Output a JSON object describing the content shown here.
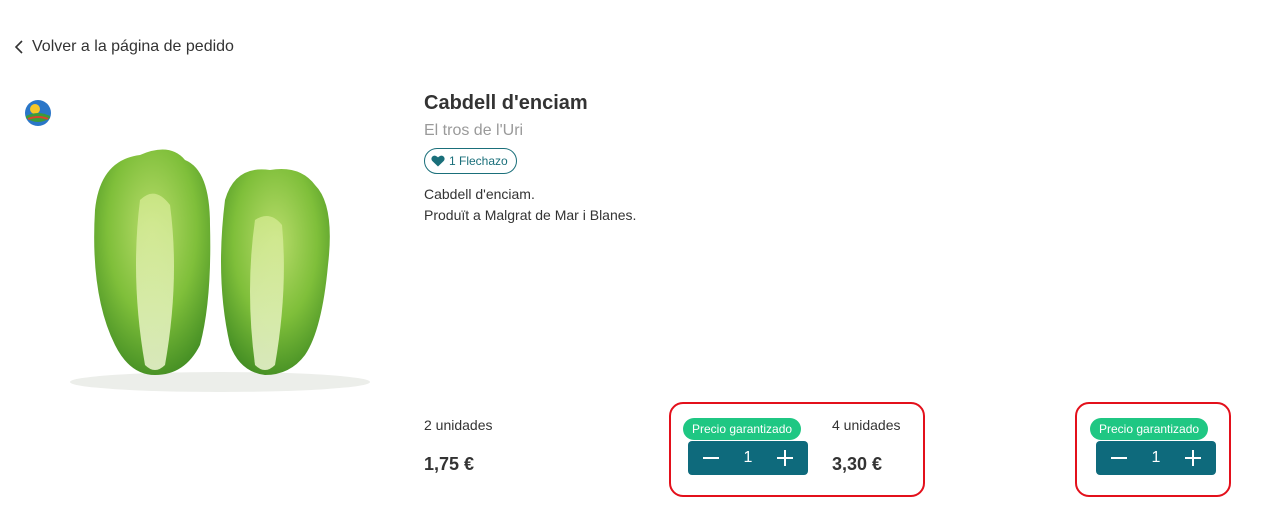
{
  "nav": {
    "back_label": "Volver a la página de pedido"
  },
  "product": {
    "name": "Cabdell d'enciam",
    "producer": "El tros de l'Uri",
    "crush_label": "1 Flechazo",
    "description_line1": "Cabdell d'enciam.",
    "description_line2": "Produït a Malgrat de Mar i Blanes."
  },
  "options": [
    {
      "units": "2 unidades",
      "price": "1,75 €",
      "guarantee": "Precio garantizado",
      "quantity": "1"
    },
    {
      "units": "4 unidades",
      "price": "3,30 €",
      "guarantee": "Precio garantizado",
      "quantity": "1"
    }
  ],
  "icons": {
    "back": "chevron-left-icon",
    "crush": "heart-icon",
    "minus": "minus-icon",
    "plus": "plus-icon",
    "badge": "organic-badge-icon"
  },
  "colors": {
    "accent": "#0e6a7c",
    "guarantee": "#1fc783",
    "highlight": "#e3101b",
    "crush": "#1a6f7a"
  }
}
